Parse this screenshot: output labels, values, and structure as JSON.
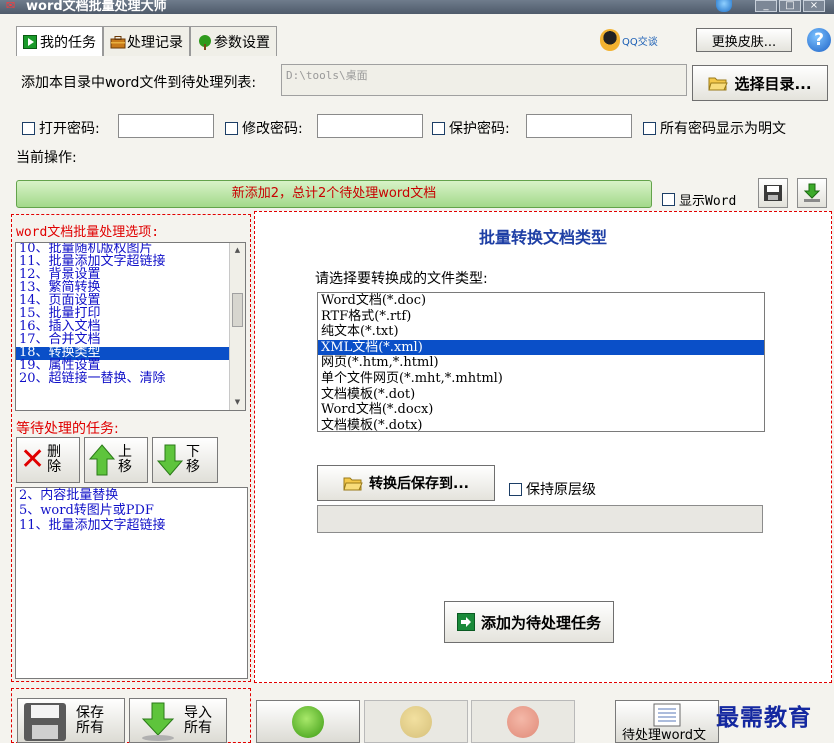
{
  "window": {
    "title": "word文档批量处理大师",
    "controls": {
      "minimize": "_",
      "maximize": "□",
      "close": "×"
    }
  },
  "tabs": [
    {
      "label": "我的任务",
      "icon": "play-icon",
      "active": true
    },
    {
      "label": "处理记录",
      "icon": "briefcase-icon",
      "active": false
    },
    {
      "label": "参数设置",
      "icon": "tree-icon",
      "active": false
    }
  ],
  "header_right": {
    "qq_label": "QQ交谈",
    "skin_button": "更换皮肤...",
    "help": "?"
  },
  "directory": {
    "label": "添加本目录中word文件到待处理列表:",
    "path": "D:\\tools\\桌面",
    "select_button": "选择目录..."
  },
  "passwords": {
    "open": "打开密码:",
    "modify": "修改密码:",
    "protect": "保护密码:",
    "show_plain": "所有密码显示为明文"
  },
  "current_op_label": "当前操作:",
  "status_message": "新添加2，总计2个待处理word文档",
  "show_word_label": "显示Word",
  "options": {
    "heading": "word文档批量处理选项:",
    "items": [
      "10、批量随机版权图片",
      "11、批量添加文字超链接",
      "12、背景设置",
      "13、繁简转换",
      "14、页面设置",
      "15、批量打印",
      "16、插入文档",
      "17、合并文档",
      "18、转换类型",
      "19、属性设置",
      "20、超链接一替换、清除"
    ],
    "selected_index": 8
  },
  "pending": {
    "heading": "等待处理的任务:",
    "delete_label": "删除",
    "up_label": "上移",
    "down_label": "下移",
    "items": [
      "2、内容批量替换",
      "5、word转图片或PDF",
      "11、批量添加文字超链接"
    ]
  },
  "convert": {
    "title": "批量转换文档类型",
    "prompt": "请选择要转换成的文件类型:",
    "types": [
      "Word文档(*.doc)",
      "RTF格式(*.rtf)",
      "纯文本(*.txt)",
      "XML文档(*.xml)",
      "网页(*.htm,*.html)",
      "单个文件网页(*.mht,*.mhtml)",
      "文档模板(*.dot)",
      "Word文档(*.docx)",
      "文档模板(*.dotx)"
    ],
    "selected_index": 3,
    "save_to_button": "转换后保存到...",
    "keep_levels_label": "保持原层级",
    "add_task_button": "添加为待处理任务"
  },
  "bottom": {
    "save_all": "保存所有",
    "import_all": "导入所有",
    "pending_word": "待处理word文"
  },
  "watermark": "最需教育",
  "colors": {
    "accent_red": "#e00000",
    "list_blue": "#1010c8",
    "selection": "#0a4fc8",
    "status_green": "#a3d98a"
  }
}
